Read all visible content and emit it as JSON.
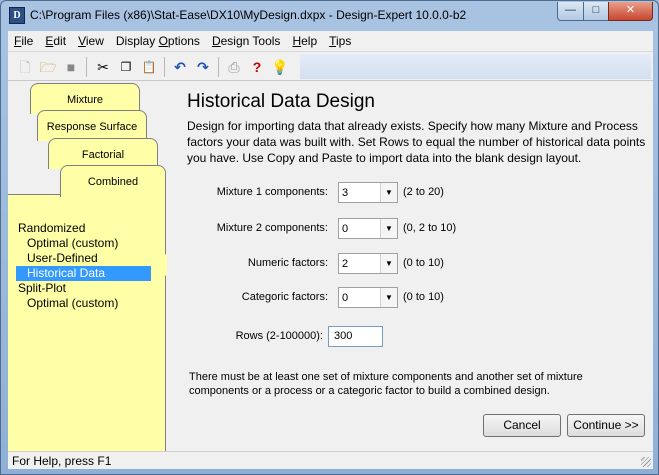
{
  "window": {
    "title": "C:\\Program Files (x86)\\Stat-Ease\\DX10\\MyDesign.dxpx - Design-Expert 10.0.0-b2",
    "app_icon_letter": "D"
  },
  "menu": [
    {
      "u": "F",
      "rest": "ile"
    },
    {
      "u": "E",
      "rest": "dit"
    },
    {
      "u": "V",
      "rest": "iew"
    },
    {
      "pre": "Display ",
      "u": "O",
      "rest": "ptions"
    },
    {
      "u": "D",
      "rest": "esign Tools"
    },
    {
      "u": "H",
      "rest": "elp"
    },
    {
      "u": "T",
      "rest": "ips"
    }
  ],
  "tabs": {
    "mixture": "Mixture",
    "response_surface": "Response Surface",
    "factorial": "Factorial",
    "combined": "Combined"
  },
  "tree": {
    "randomized": "Randomized",
    "optimal_custom": "Optimal (custom)",
    "user_defined": "User-Defined",
    "historical_data": "Historical Data",
    "split_plot": "Split-Plot",
    "split_optimal_custom": "Optimal (custom)"
  },
  "main": {
    "title": "Historical Data Design",
    "description": "Design for importing data that already exists. Specify how many Mixture and Process factors your data was built with. Set Rows to equal the number of historical data points you have. Use Copy and Paste to import data into the blank design layout.",
    "fields": {
      "mixture1": {
        "label": "Mixture 1 components:",
        "value": "3",
        "range": "(2 to 20)"
      },
      "mixture2": {
        "label": "Mixture 2 components:",
        "value": "0",
        "range": "(0, 2 to 10)"
      },
      "numeric": {
        "label": "Numeric factors:",
        "value": "2",
        "range": "(0 to 10)"
      },
      "categoric": {
        "label": "Categoric factors:",
        "value": "0",
        "range": "(0 to 10)"
      },
      "rows": {
        "label": "Rows (2-100000):",
        "value": "300"
      }
    },
    "note": "There must be at least one set of mixture components and another set of mixture components or a process or a categoric factor to build a combined design.",
    "cancel_label": "Cancel",
    "continue_label": "Continue >>"
  },
  "status": {
    "text": "For Help, press F1"
  }
}
